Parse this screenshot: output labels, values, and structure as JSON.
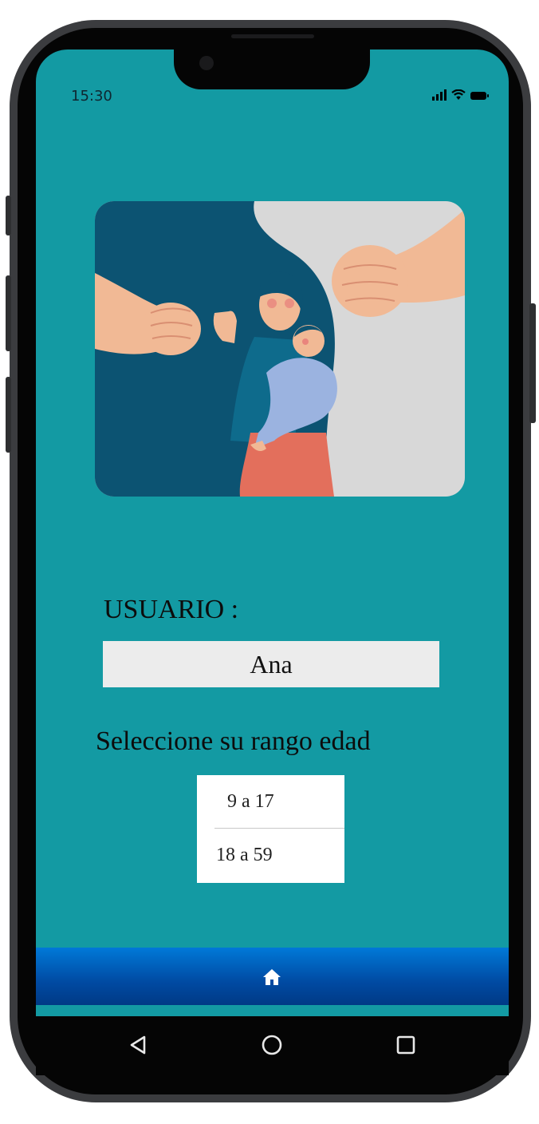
{
  "status_bar": {
    "time": "15:30",
    "icons": [
      "signal-icon",
      "wifi-icon",
      "battery-icon"
    ]
  },
  "illustration": {
    "subject": "illustration"
  },
  "user": {
    "label": "USUARIO :",
    "value": "Ana"
  },
  "age": {
    "prompt": "Seleccione su rango edad",
    "options": [
      {
        "label": "9 a 17"
      },
      {
        "label": "18 a 59"
      }
    ]
  },
  "bottom_nav": {
    "icon": "home-icon"
  },
  "system_nav": {
    "icons": [
      "back-icon",
      "home-circle-icon",
      "recents-icon"
    ]
  },
  "colors": {
    "screen_bg": "#139aa3",
    "nav_bar": "#0079d8",
    "phone_frame": "#3b3c3f"
  }
}
